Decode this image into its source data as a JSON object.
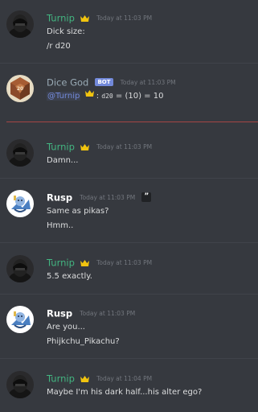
{
  "messages": [
    {
      "author": "Turnip",
      "timestamp": "Today at 11:03 PM",
      "lines": [
        "Dick size:",
        "/r d20"
      ]
    },
    {
      "author": "Dice God",
      "badge": "BOT",
      "timestamp": "Today at 11:03 PM",
      "mention": "@Turnip",
      "colon": ":",
      "dice": "d20",
      "result": " = (10) = 10"
    },
    {
      "author": "Turnip",
      "timestamp": "Today at 11:03 PM",
      "lines": [
        "Damn..."
      ]
    },
    {
      "author": "Rusp",
      "timestamp": "Today at 11:03 PM",
      "quote_badge": "”",
      "lines": [
        "Same as pikas?",
        "Hmm.."
      ]
    },
    {
      "author": "Turnip",
      "timestamp": "Today at 11:03 PM",
      "lines": [
        "5.5 exactly."
      ]
    },
    {
      "author": "Rusp",
      "timestamp": "Today at 11:03 PM",
      "lines": [
        "Are you...",
        "Phijkchu_Pikachu?"
      ]
    },
    {
      "author": "Turnip",
      "timestamp": "Today at 11:04 PM",
      "lines": [
        "Maybe I'm his dark half...his alter ego?"
      ]
    }
  ],
  "colors": {
    "background": "#36393f",
    "turnip_name": "#43b581",
    "dice_god_name": "#99aab5",
    "rusp_name": "#ffffff",
    "bot_badge": "#7289da",
    "crown": "#f1c40f",
    "new_message_divider": "#a54545"
  }
}
